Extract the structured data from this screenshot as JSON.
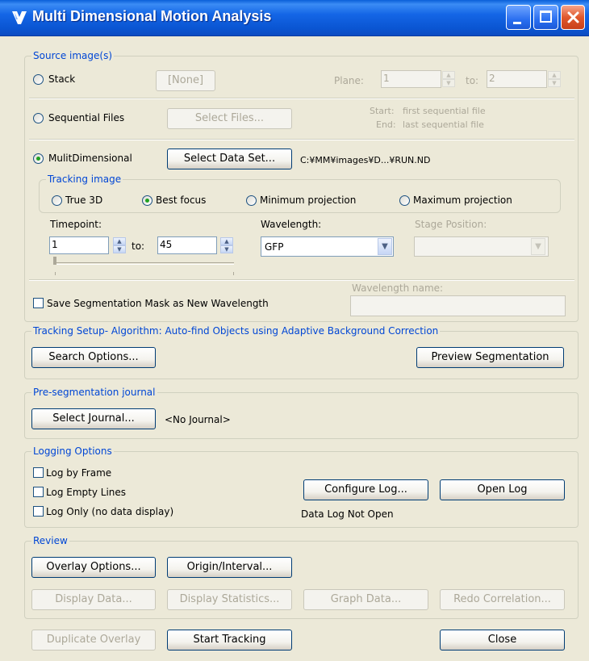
{
  "window": {
    "title": "Multi Dimensional Motion Analysis"
  },
  "source": {
    "legend": "Source image(s)",
    "stack_label": "Stack",
    "none_button": "[None]",
    "plane_label": "Plane:",
    "plane_from": "1",
    "plane_to_label": "to:",
    "plane_to": "2",
    "sequential_label": "Sequential Files",
    "select_files_button": "Select Files...",
    "start_label": "Start:",
    "start_value": "first sequential file",
    "end_label": "End:",
    "end_value": "last sequential file",
    "multidim_label": "MulitDimensional",
    "select_dataset_button": "Select Data Set...",
    "dataset_path": "C:¥MM¥images¥D...¥RUN.ND",
    "tracking_legend": "Tracking image",
    "true3d_label": "True 3D",
    "best_focus_label": "Best focus",
    "min_proj_label": "Minimum projection",
    "max_proj_label": "Maximum projection",
    "timepoint_label": "Timepoint:",
    "timepoint_from": "1",
    "timepoint_to_label": "to:",
    "timepoint_to": "45",
    "wavelength_label": "Wavelength:",
    "wavelength_value": "GFP",
    "stage_position_label": "Stage Position:",
    "save_mask_label": "Save Segmentation Mask as New Wavelength",
    "wavelength_name_label": "Wavelength name:"
  },
  "tracking": {
    "legend": "Tracking Setup- Algorithm: Auto-find Objects using Adaptive Background Correction",
    "search_options_button": "Search Options...",
    "preview_button": "Preview Segmentation"
  },
  "journal": {
    "legend": "Pre-segmentation journal",
    "select_journal_button": "Select Journal...",
    "journal_value": "<No Journal>"
  },
  "logging": {
    "legend": "Logging Options",
    "log_by_frame": "Log by Frame",
    "log_empty_lines": "Log Empty Lines",
    "log_only": "Log Only (no data display)",
    "configure_button": "Configure Log...",
    "open_log_button": "Open Log",
    "status": "Data Log Not Open"
  },
  "review": {
    "legend": "Review",
    "overlay_options_button": "Overlay Options...",
    "origin_interval_button": "Origin/Interval...",
    "display_data_button": "Display Data...",
    "display_statistics_button": "Display Statistics...",
    "graph_data_button": "Graph Data...",
    "redo_correlation_button": "Redo Correlation..."
  },
  "footer": {
    "duplicate_overlay_button": "Duplicate Overlay",
    "start_tracking_button": "Start Tracking",
    "close_button": "Close"
  },
  "selection": {
    "source_mode": "MulitDimensional",
    "tracking_image": "Best focus",
    "timepoint_slider_fraction": 0.0
  }
}
